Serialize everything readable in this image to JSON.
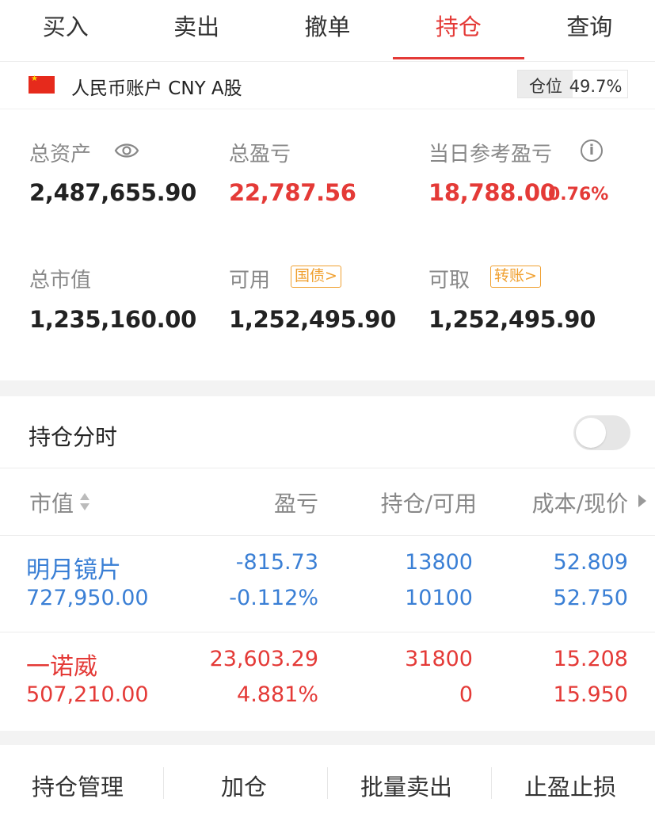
{
  "tabs": [
    {
      "label": "买入"
    },
    {
      "label": "卖出"
    },
    {
      "label": "撤单"
    },
    {
      "label": "持仓"
    },
    {
      "label": "查询"
    }
  ],
  "active_tab": "持仓",
  "account": {
    "name": "人民币账户 CNY A股",
    "position_label": "仓位",
    "position_pct": "49.7%",
    "position_fraction": 0.497
  },
  "summary": {
    "total_assets_label": "总资产",
    "total_assets": "2,487,655.90",
    "total_pl_label": "总盈亏",
    "total_pl": "22,787.56",
    "daily_pl_label": "当日参考盈亏",
    "daily_pl": "18,788.00",
    "daily_pl_pct": "0.76%",
    "market_value_label": "总市值",
    "market_value": "1,235,160.00",
    "available_label": "可用",
    "available": "1,252,495.90",
    "available_chip": "国债>",
    "withdrawable_label": "可取",
    "withdrawable": "1,252,495.90",
    "withdrawable_chip": "转账>"
  },
  "intraday": {
    "label": "持仓分时",
    "enabled": false
  },
  "table": {
    "headers": {
      "market_value": "市值",
      "pl": "盈亏",
      "hold": "持仓/可用",
      "cost": "成本/现价"
    },
    "rows": [
      {
        "name": "明月镜片",
        "market_value": "727,950.00",
        "pl": "-815.73",
        "pl_pct": "-0.112%",
        "hold": "13800",
        "available": "10100",
        "cost": "52.809",
        "price": "52.750"
      },
      {
        "name": "一诺威",
        "market_value": "507,210.00",
        "pl": "23,603.29",
        "pl_pct": "4.881%",
        "hold": "31800",
        "available": "0",
        "cost": "15.208",
        "price": "15.950"
      }
    ]
  },
  "bottom_actions": [
    {
      "label": "持仓管理"
    },
    {
      "label": "加仓"
    },
    {
      "label": "批量卖出"
    },
    {
      "label": "止盈止损"
    }
  ],
  "colors": {
    "accent_red": "#e43a37",
    "loss_blue": "#3a7fd5",
    "chip_orange": "#f0a030"
  }
}
